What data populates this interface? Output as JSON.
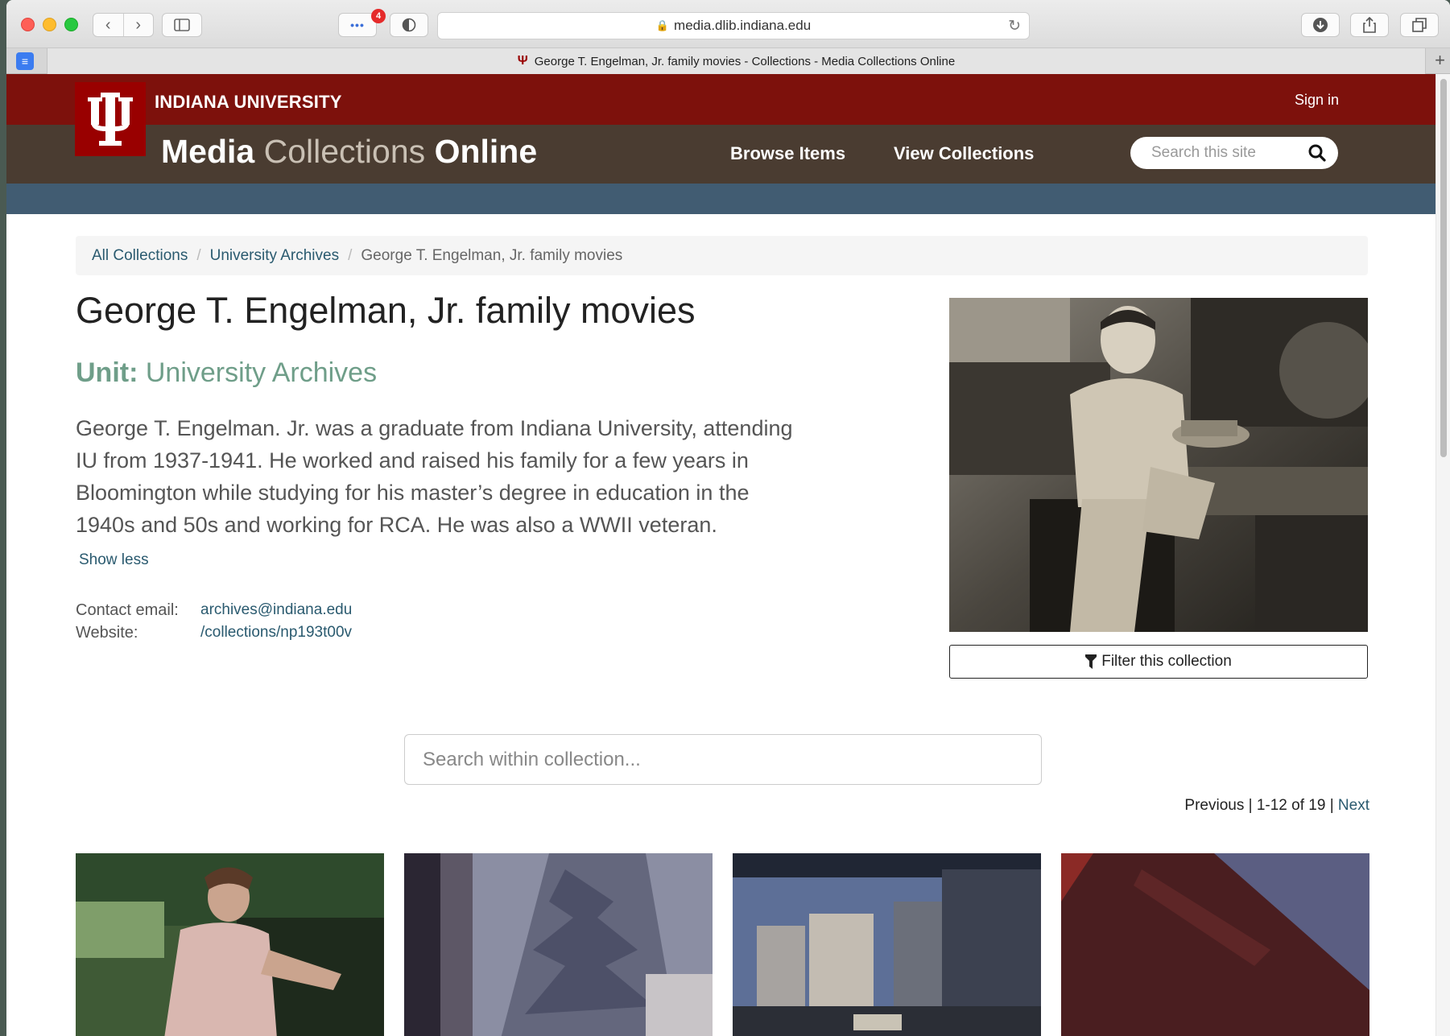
{
  "browser": {
    "url": "media.dlib.indiana.edu",
    "tab_title": "George T. Engelman, Jr. family movies - Collections - Media Collections Online",
    "extension_badge": "4"
  },
  "header": {
    "university": "INDIANA UNIVERSITY",
    "signin": "Sign in",
    "site_title_1": "Media",
    "site_title_2": "Collections",
    "site_title_3": "Online",
    "nav": [
      "Browse Items",
      "View Collections"
    ],
    "search_placeholder": "Search this site"
  },
  "breadcrumb": {
    "items": [
      "All Collections",
      "University Archives"
    ],
    "current": "George T. Engelman, Jr. family movies"
  },
  "collection": {
    "title": "George T. Engelman, Jr. family movies",
    "unit_label": "Unit:",
    "unit_value": "University Archives",
    "description_lines": [
      "George T. Engelman. Jr. was a graduate from Indiana University, attending",
      "IU from 1937-1941. He worked and raised his family for a few years in",
      "Bloomington while studying for his master’s degree in education in the",
      "1940s and 50s and working for RCA. He was also a WWII veteran."
    ],
    "show_less": "Show less",
    "contact_email_label": "Contact email:",
    "contact_email": "archives@indiana.edu",
    "website_label": "Website:",
    "website": "/collections/np193t00v",
    "filter_button": "Filter this collection"
  },
  "search_collection": {
    "placeholder": "Search within collection..."
  },
  "pager": {
    "previous": "Previous",
    "separator": "|",
    "range": "1-12 of 19",
    "next": "Next"
  },
  "colors": {
    "iu_crimson": "#990000",
    "header_red": "#7d110c",
    "header_brown": "#4a3c31",
    "header_blue": "#415c72",
    "unit_green": "#6f9e89",
    "link": "#2a5a6f"
  }
}
